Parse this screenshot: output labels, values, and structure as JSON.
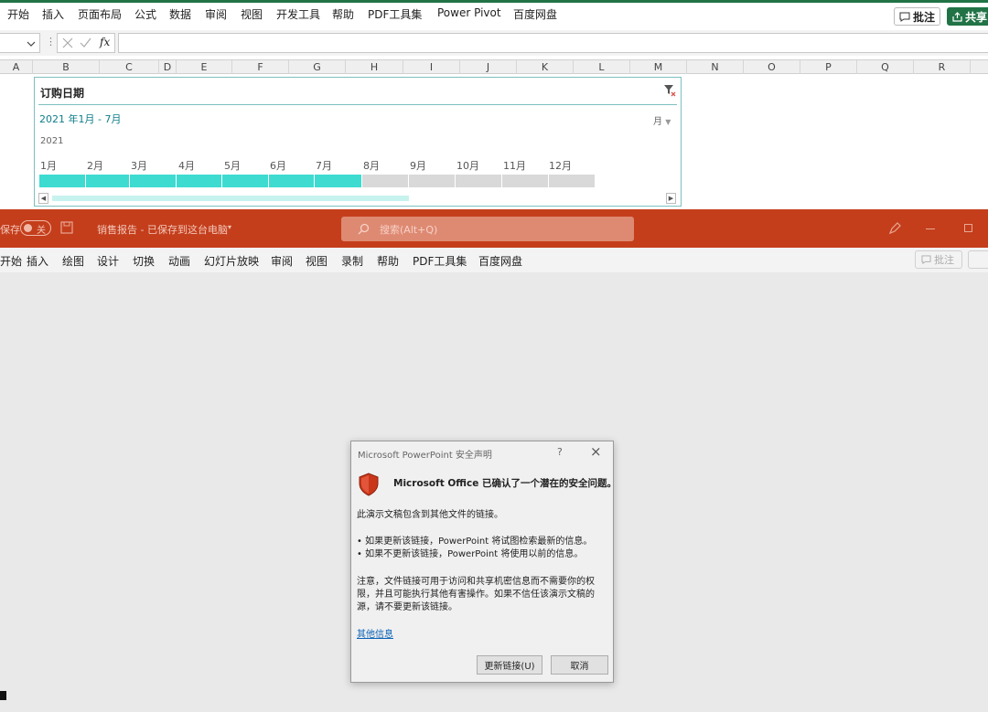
{
  "excel": {
    "menu": [
      "开始",
      "插入",
      "页面布局",
      "公式",
      "数据",
      "审阅",
      "视图",
      "开发工具",
      "帮助",
      "PDF工具集",
      "Power Pivot",
      "百度网盘"
    ],
    "comments_label": "批注",
    "share_label": "共享",
    "fx_label": "fx",
    "columns": [
      "A",
      "B",
      "C",
      "D",
      "E",
      "F",
      "G",
      "H",
      "I",
      "J",
      "K",
      "L",
      "M",
      "N",
      "O",
      "P",
      "Q",
      "R"
    ]
  },
  "timeline": {
    "title": "订购日期",
    "range_label": "2021 年1月 - 7月",
    "level_label": "月",
    "year_label": "2021",
    "months": [
      "1月",
      "2月",
      "3月",
      "4月",
      "5月",
      "6月",
      "7月",
      "8月",
      "9月",
      "10月",
      "11月",
      "12月"
    ],
    "selected_months": 7,
    "colors": {
      "selected": "#3ddbd0",
      "unselected": "#d9d9d9",
      "accent": "#0e7d8a"
    }
  },
  "powerpoint": {
    "autosave_label": "保存",
    "autosave_state": "关",
    "doc_title": "销售报告 - 已保存到这台电脑",
    "search_placeholder": "搜索(Alt+Q)",
    "menu": [
      "开始",
      "插入",
      "绘图",
      "设计",
      "切换",
      "动画",
      "幻灯片放映",
      "审阅",
      "视图",
      "录制",
      "帮助",
      "PDF工具集",
      "百度网盘"
    ],
    "comments_label": "批注",
    "accent_color": "#c43e1c"
  },
  "dialog": {
    "title": "Microsoft PowerPoint 安全声明",
    "help_glyph": "?",
    "close_glyph": "×",
    "heading": "Microsoft Office 已确认了一个潜在的安全问题。",
    "intro": "此演示文稿包含到其他文件的链接。",
    "bullet1": "• 如果更新该链接，PowerPoint 将试图检索最新的信息。",
    "bullet2": "• 如果不更新该链接，PowerPoint 将使用以前的信息。",
    "note_line1": "注意，文件链接可用于访问和共享机密信息而不需要你的权",
    "note_line2": "限，并且可能执行其他有害操作。如果不信任该演示文稿的",
    "note_line3": "源，请不要更新该链接。",
    "more_info_link": "其他信息",
    "update_button": "更新链接(U)",
    "cancel_button": "取消"
  }
}
